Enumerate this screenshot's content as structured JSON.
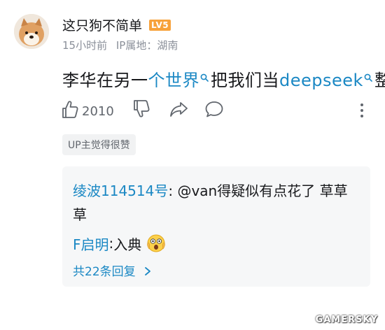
{
  "comment": {
    "username": "这只狗不简单",
    "level": "LV5",
    "time": "15小时前",
    "ip_location": "IP属地：湖南",
    "text_parts": [
      {
        "text": "李华在另一",
        "link": false
      },
      {
        "text": "个世界",
        "link": true
      },
      {
        "text": "把我们当",
        "link": false
      },
      {
        "text": "deepseek",
        "link": true
      },
      {
        "text": "整",
        "link": false
      }
    ],
    "like_count": "2010",
    "up_badge": "UP主觉得很赞"
  },
  "replies": [
    {
      "username": "绫波114514号",
      "separator": ": ",
      "text": "@van得疑似有点花了 草草草"
    },
    {
      "username": "F启明",
      "separator": ": ",
      "text": "入典"
    }
  ],
  "more_replies": "共22条回复",
  "icons": {
    "like": "thumbs-up-icon",
    "dislike": "thumbs-down-icon",
    "share": "share-icon",
    "comment": "comment-icon",
    "more": "more-vertical-icon",
    "search": "search-icon",
    "emoji": "shocked-face-emoji"
  },
  "colors": {
    "link": "#1b88c4",
    "level_badge": "#f7a23b",
    "muted": "#8a8f99"
  },
  "watermark": "GAMERSKY"
}
